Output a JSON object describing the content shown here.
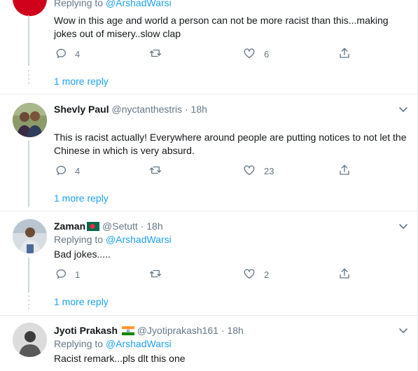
{
  "tweets": [
    {
      "replying_prefix": "Replying to",
      "replying_handle": "@ArshadWarsi",
      "text": "Wow in this age and world a person can not be more racist than this...making jokes out of misery..slow clap",
      "reply_count": "4",
      "like_count": "6",
      "more_reply": "1 more reply"
    },
    {
      "name": "Shevly Paul",
      "handle": "@nyctanthestris",
      "time": "18h",
      "text": "This is racist actually! Everywhere around people are putting notices to not let the Chinese in which is very absurd.",
      "reply_count": "4",
      "like_count": "23",
      "more_reply": "1 more reply"
    },
    {
      "name": "Zaman",
      "flag": "bangladesh-flag-icon",
      "handle": "@Setutt",
      "time": "18h",
      "replying_prefix": "Replying to",
      "replying_handle": "@ArshadWarsi",
      "text": "Bad jokes.....",
      "reply_count": "1",
      "like_count": "2",
      "more_reply": "1 more reply"
    },
    {
      "name": "Jyoti Prakash",
      "flag": "india-flag-icon",
      "handle": "@Jyotiprakash161",
      "time": "18h",
      "replying_prefix": "Replying to",
      "replying_handle": "@ArshadWarsi",
      "text": "Racist remark...pls dlt this one"
    }
  ],
  "separator": "·",
  "colors": {
    "link": "#1da1f2",
    "muted": "#657786",
    "text": "#14171a",
    "border": "#e6ecf0"
  }
}
